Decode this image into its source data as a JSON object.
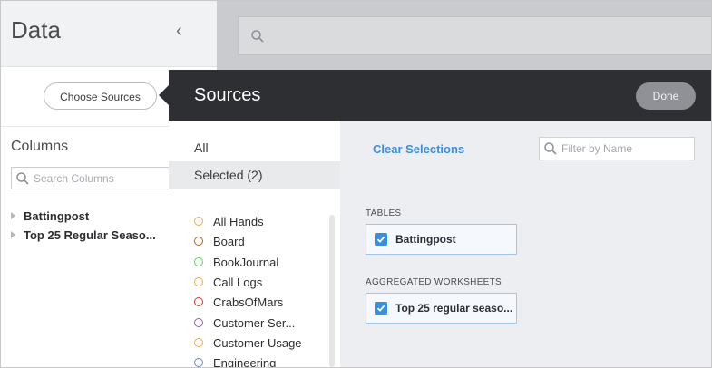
{
  "data_panel": {
    "title": "Data",
    "collapse_glyph": "‹",
    "choose_sources_label": "Choose Sources",
    "columns_title": "Columns",
    "search_placeholder": "Search Columns",
    "columns": [
      {
        "label": "Battingpost"
      },
      {
        "label": "Top 25 Regular Seaso..."
      }
    ]
  },
  "top_search": {
    "icon": "search-icon",
    "value": ""
  },
  "sources_modal": {
    "title": "Sources",
    "done_label": "Done",
    "filters": {
      "all": "All",
      "selected": "Selected (2)"
    },
    "sources": [
      {
        "label": "All Hands",
        "color": "#f2a94a"
      },
      {
        "label": "Board",
        "color": "#b5651d"
      },
      {
        "label": "BookJournal",
        "color": "#5bd35b"
      },
      {
        "label": "Call Logs",
        "color": "#f2a94a"
      },
      {
        "label": "CrabsOfMars",
        "color": "#e0322a"
      },
      {
        "label": "Customer Ser...",
        "color": "#9b59b6"
      },
      {
        "label": "Customer Usage",
        "color": "#f2a94a"
      },
      {
        "label": "Engineering",
        "color": "#6b7fd7"
      }
    ],
    "clear_selections": "Clear Selections",
    "name_filter_placeholder": "Filter by Name",
    "tables_label": "TABLES",
    "tables": [
      {
        "label": "Battingpost",
        "checked": true
      }
    ],
    "aggregated_label": "AGGREGATED WORKSHEETS",
    "aggregated": [
      {
        "label": "Top 25 regular seaso...",
        "checked": true
      }
    ]
  }
}
